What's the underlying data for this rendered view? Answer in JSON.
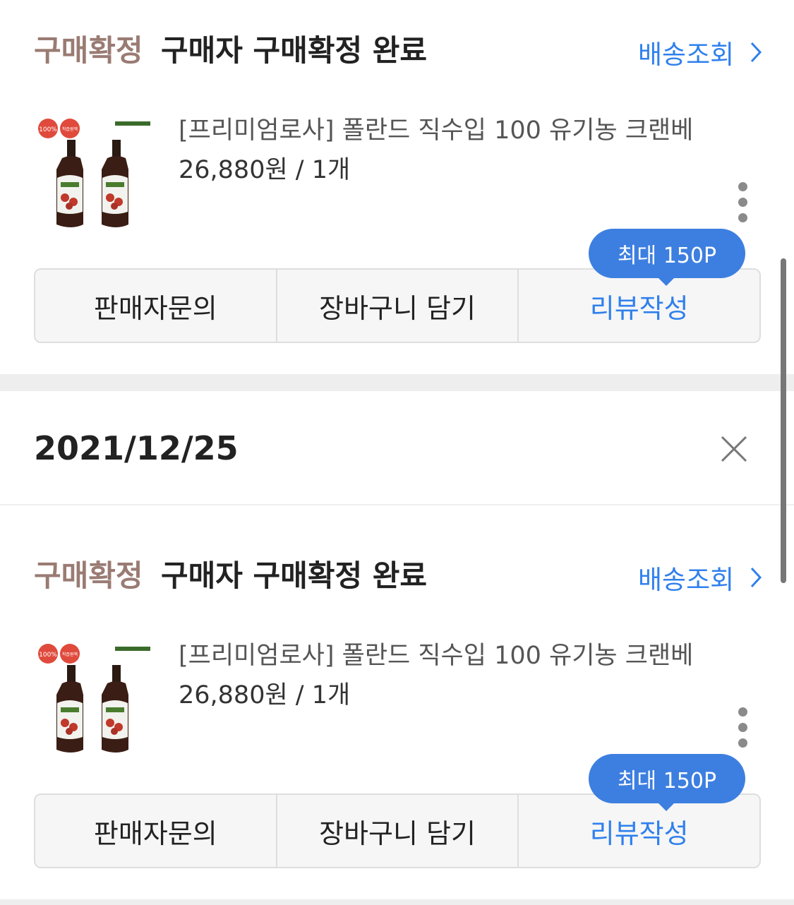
{
  "orders": [
    {
      "status_label": "구매확정",
      "status_desc": "구매자 구매확정 완료",
      "track_label": "배송조회",
      "product_name": "[프리미엄로사] 폴란드 직수입 100 유기농 크랜베",
      "product_price": "26,880원 / 1개",
      "badge": "최대 150P",
      "buttons": {
        "inquiry": "판매자문의",
        "cart": "장바구니 담기",
        "review": "리뷰작성"
      }
    },
    {
      "status_label": "구매확정",
      "status_desc": "구매자 구매확정 완료",
      "track_label": "배송조회",
      "product_name": "[프리미엄로사] 폴란드 직수입 100 유기농 크랜베",
      "product_price": "26,880원 / 1개",
      "badge": "최대 150P",
      "buttons": {
        "inquiry": "판매자문의",
        "cart": "장바구니 담기",
        "review": "리뷰작성"
      }
    }
  ],
  "date_header": "2021/12/25",
  "product_image": {
    "badge_text": "100%",
    "badge_text_2": "착즙원액"
  },
  "colors": {
    "accent": "#2f80ed",
    "status": "#9a7b73",
    "badge_bg": "#3d7fe0",
    "separator": "#eeeeee"
  },
  "icons": {
    "track": "chevron-right-icon",
    "more": "more-vertical-icon",
    "close": "close-icon"
  }
}
